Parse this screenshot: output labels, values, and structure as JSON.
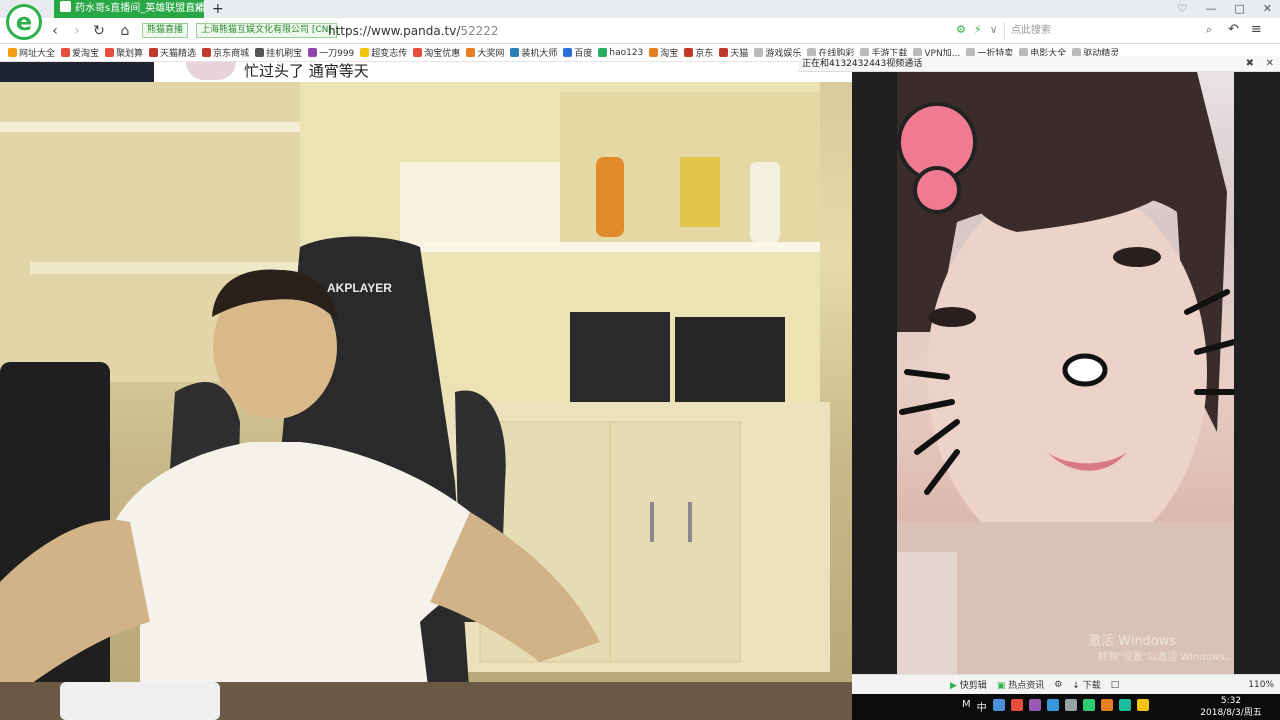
{
  "browser": {
    "logo_letter": "e",
    "tab_title": "药水哥s直播间_英雄联盟直播 ...",
    "tab_close": "×",
    "new_tab": "+",
    "window_controls": [
      "♡",
      "—",
      "□",
      "✕"
    ],
    "site_name": "熊猫直播",
    "cert_owner": "上海熊猫互娱文化有限公司 [CN]",
    "url_host": "https://www.panda.tv/",
    "url_path": "52222",
    "search_placeholder": "点此搜索",
    "bookmarks": [
      {
        "label": "网址大全",
        "color": "#f39c12"
      },
      {
        "label": "爱淘宝",
        "color": "#e74c3c"
      },
      {
        "label": "聚划算",
        "color": "#e74c3c"
      },
      {
        "label": "天猫精选",
        "color": "#c0392b"
      },
      {
        "label": "京东商城",
        "color": "#c0392b"
      },
      {
        "label": "挂机刷宝",
        "color": "#555555"
      },
      {
        "label": "一刀999",
        "color": "#8e44ad"
      },
      {
        "label": "超变志传",
        "color": "#f1c40f"
      },
      {
        "label": "淘宝优惠",
        "color": "#e74c3c"
      },
      {
        "label": "大奖网",
        "color": "#e67e22"
      },
      {
        "label": "装机大师",
        "color": "#2980b9"
      },
      {
        "label": "百度",
        "color": "#2c6fd6"
      },
      {
        "label": "hao123",
        "color": "#27ae60"
      },
      {
        "label": "淘宝",
        "color": "#e67e22"
      },
      {
        "label": "京东",
        "color": "#c0392b"
      },
      {
        "label": "天猫",
        "color": "#c0392b"
      },
      {
        "label": "游戏娱乐",
        "color": "#bbbbbb"
      },
      {
        "label": "在线购彩",
        "color": "#bbbbbb"
      },
      {
        "label": "手游下载",
        "color": "#bbbbbb"
      },
      {
        "label": "VPN加...",
        "color": "#bbbbbb"
      },
      {
        "label": "一折特卖",
        "color": "#bbbbbb"
      },
      {
        "label": "电影大全",
        "color": "#bbbbbb"
      },
      {
        "label": "驱动精灵",
        "color": "#bbbbbb"
      }
    ]
  },
  "stream": {
    "overlay_text": "忙过头了 通宵等天",
    "chair_brand": "AKPLAYER"
  },
  "call_window": {
    "header": "正在和4132432443视频通话",
    "watermark_line1": "激活 Windows",
    "watermark_line2": "转到\"设置\"以激活 Windows。"
  },
  "statusbar": {
    "items": [
      "快剪辑",
      "热点资讯"
    ],
    "download": "下载",
    "zoom": "110%"
  },
  "taskbar": {
    "time": "5:32",
    "date": "2018/8/3/周五",
    "tray_colors": [
      "#4a90d9",
      "#e74c3c",
      "#9b59b6",
      "#3498db",
      "#95a5a6",
      "#2ecc71",
      "#e67e22",
      "#1abc9c",
      "#f1c40f"
    ]
  }
}
